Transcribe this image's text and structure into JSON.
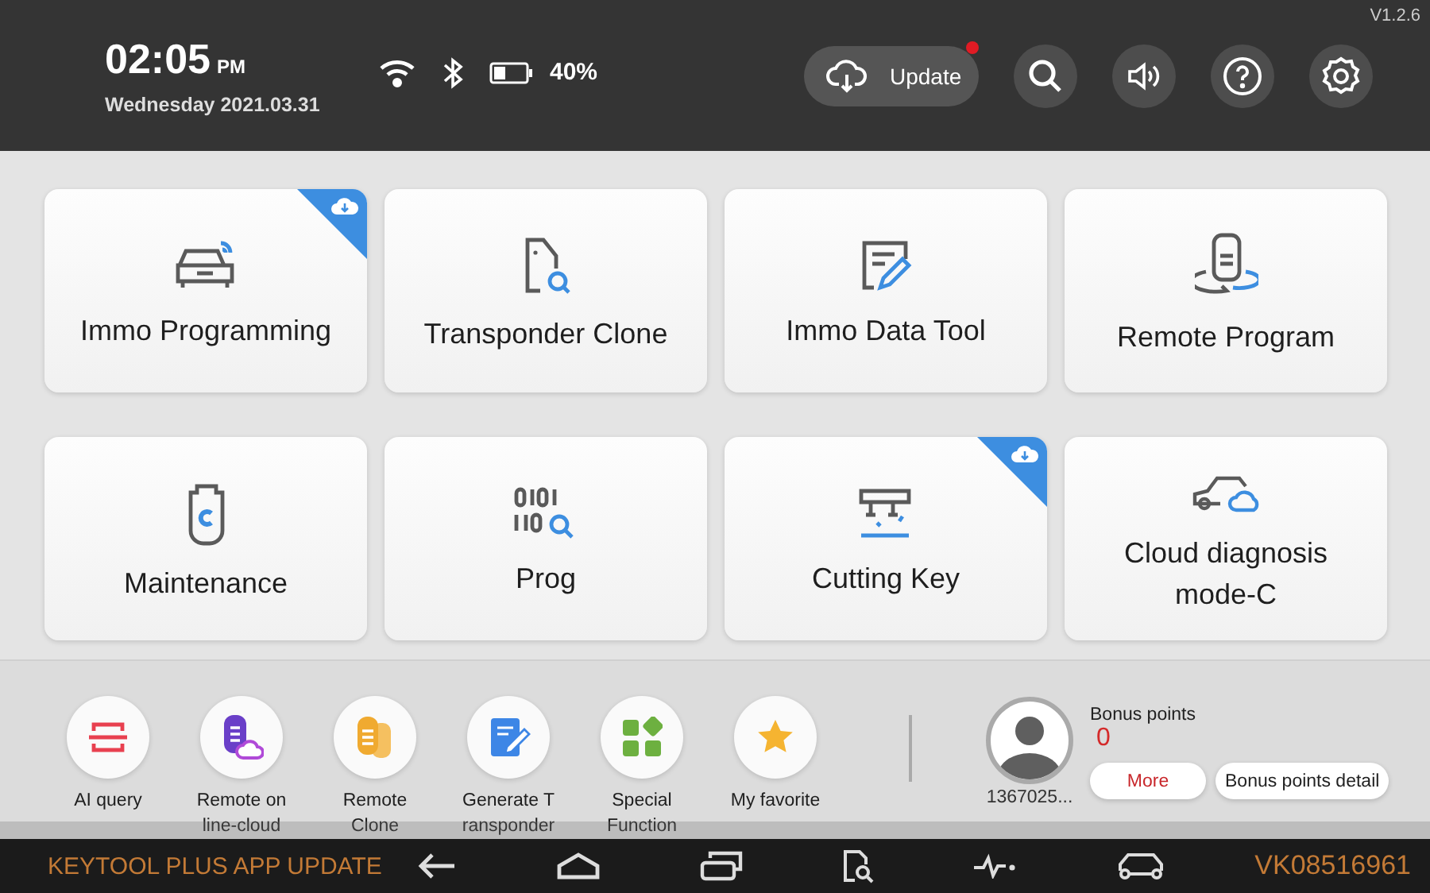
{
  "version": "V1.2.6",
  "status": {
    "time": "02:05",
    "ampm": "PM",
    "date": "Wednesday 2021.03.31",
    "battery_text": "40%"
  },
  "update_button": {
    "label": "Update",
    "notification": true
  },
  "toolbar": [
    {
      "kind": "search"
    },
    {
      "kind": "sound"
    },
    {
      "kind": "help"
    },
    {
      "kind": "settings"
    }
  ],
  "modules": [
    {
      "label": "Immo Programming",
      "kind": "car-signal",
      "download": true
    },
    {
      "label": "Transponder Clone",
      "kind": "tag-search",
      "download": false
    },
    {
      "label": "Immo Data Tool",
      "kind": "doc-edit",
      "download": false
    },
    {
      "label": "Remote Program",
      "kind": "remote",
      "download": false
    },
    {
      "label": "Maintenance",
      "kind": "key-fob",
      "download": false
    },
    {
      "label": "Prog",
      "kind": "binary",
      "download": false
    },
    {
      "label": "Cutting Key",
      "kind": "cutter",
      "download": true
    },
    {
      "label": "Cloud diagnosis mode-C",
      "kind": "car-cloud",
      "download": false
    }
  ],
  "shortcuts": [
    {
      "lines": [
        "AI query"
      ],
      "kind": "scan"
    },
    {
      "lines": [
        "Remote on",
        "line-cloud"
      ],
      "kind": "remote-cloud"
    },
    {
      "lines": [
        "Remote",
        "Clone"
      ],
      "kind": "remote-clone"
    },
    {
      "lines": [
        "Generate T",
        "ransponder"
      ],
      "kind": "note"
    },
    {
      "lines": [
        "Special",
        "Function"
      ],
      "kind": "apps"
    },
    {
      "lines": [
        "My favorite"
      ],
      "kind": "star"
    }
  ],
  "user": {
    "id": "1367025...",
    "bonus_label": "Bonus points",
    "bonus_value": "0",
    "buttons": [
      "More",
      "Bonus points detail"
    ]
  },
  "nav": {
    "banner": "KEYTOOL PLUS APP UPDATE",
    "serial": "VK08516961",
    "buttons": [
      {
        "kind": "back"
      },
      {
        "kind": "home"
      },
      {
        "kind": "recent"
      },
      {
        "kind": "doc-search"
      },
      {
        "kind": "pulse"
      },
      {
        "kind": "car"
      }
    ]
  }
}
